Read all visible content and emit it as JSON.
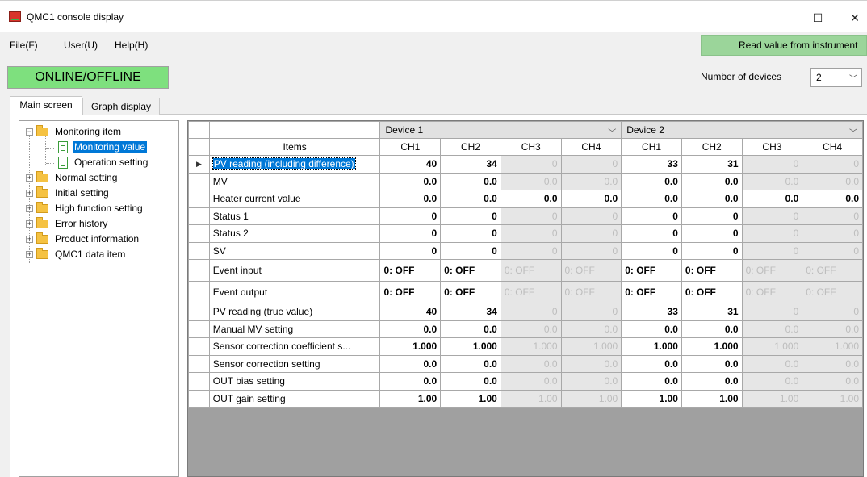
{
  "window": {
    "title": "QMC1 console display",
    "minimize": "—",
    "maximize": "☐",
    "close": "✕"
  },
  "menu": {
    "file": "File(F)",
    "user": "User(U)",
    "help": "Help(H)"
  },
  "read_button": "Read value from instrument",
  "online_button": "ONLINE/OFFLINE",
  "devices": {
    "label": "Number of devices",
    "value": "2"
  },
  "tabs": {
    "main": "Main screen",
    "graph": "Graph display"
  },
  "tree": {
    "monitoring_item": "Monitoring item",
    "monitoring_value": "Monitoring value",
    "operation_setting": "Operation setting",
    "normal_setting": "Normal setting",
    "initial_setting": "Initial setting",
    "high_function_setting": "High function setting",
    "error_history": "Error history",
    "product_information": "Product information",
    "qmc1_data_item": "QMC1 data item"
  },
  "grid": {
    "device1": "Device 1",
    "device2": "Device 2",
    "items_header": "Items",
    "channels": [
      "CH1",
      "CH2",
      "CH3",
      "CH4",
      "CH1",
      "CH2",
      "CH3",
      "CH4"
    ],
    "rows": [
      {
        "label": "PV reading (including difference)",
        "values": [
          "40",
          "34",
          "0",
          "0",
          "33",
          "31",
          "0",
          "0"
        ]
      },
      {
        "label": "MV",
        "values": [
          "0.0",
          "0.0",
          "0.0",
          "0.0",
          "0.0",
          "0.0",
          "0.0",
          "0.0"
        ]
      },
      {
        "label": "Heater current value",
        "values": [
          "0.0",
          "0.0",
          "0.0",
          "0.0",
          "0.0",
          "0.0",
          "0.0",
          "0.0"
        ]
      },
      {
        "label": "Status 1",
        "values": [
          "0",
          "0",
          "0",
          "0",
          "0",
          "0",
          "0",
          "0"
        ]
      },
      {
        "label": "Status 2",
        "values": [
          "0",
          "0",
          "0",
          "0",
          "0",
          "0",
          "0",
          "0"
        ]
      },
      {
        "label": "SV",
        "values": [
          "0",
          "0",
          "0",
          "0",
          "0",
          "0",
          "0",
          "0"
        ]
      },
      {
        "label": "Event input",
        "values": [
          "0: OFF",
          "0: OFF",
          "0: OFF",
          "0: OFF",
          "0: OFF",
          "0: OFF",
          "0: OFF",
          "0: OFF"
        ]
      },
      {
        "label": "Event output",
        "values": [
          "0: OFF",
          "0: OFF",
          "0: OFF",
          "0: OFF",
          "0: OFF",
          "0: OFF",
          "0: OFF",
          "0: OFF"
        ]
      },
      {
        "label": "PV reading (true value)",
        "values": [
          "40",
          "34",
          "0",
          "0",
          "33",
          "31",
          "0",
          "0"
        ]
      },
      {
        "label": "Manual MV setting",
        "values": [
          "0.0",
          "0.0",
          "0.0",
          "0.0",
          "0.0",
          "0.0",
          "0.0",
          "0.0"
        ]
      },
      {
        "label": "Sensor correction coefficient s...",
        "values": [
          "1.000",
          "1.000",
          "1.000",
          "1.000",
          "1.000",
          "1.000",
          "1.000",
          "1.000"
        ]
      },
      {
        "label": "Sensor correction setting",
        "values": [
          "0.0",
          "0.0",
          "0.0",
          "0.0",
          "0.0",
          "0.0",
          "0.0",
          "0.0"
        ]
      },
      {
        "label": "OUT bias setting",
        "values": [
          "0.0",
          "0.0",
          "0.0",
          "0.0",
          "0.0",
          "0.0",
          "0.0",
          "0.0"
        ]
      },
      {
        "label": "OUT gain setting",
        "values": [
          "1.00",
          "1.00",
          "1.00",
          "1.00",
          "1.00",
          "1.00",
          "1.00",
          "1.00"
        ]
      }
    ]
  },
  "colors": {
    "online": "#7ee07e",
    "read_button": "#9bd59a",
    "selection": "#0078d7",
    "disabled_cell": "#e6e6e6"
  }
}
